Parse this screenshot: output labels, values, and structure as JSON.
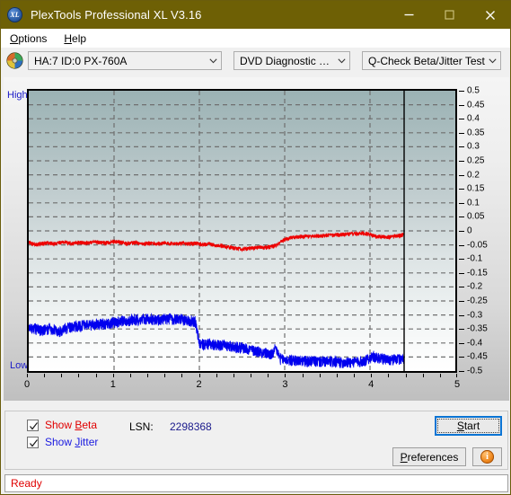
{
  "window": {
    "title": "PlexTools Professional XL V3.16",
    "icon": "xl-logo-icon",
    "minimize_label": "minimize-icon",
    "maximize_label": "maximize-icon",
    "close_label": "close-icon",
    "titlebar_color": "#6e6005"
  },
  "menu": {
    "items": [
      {
        "label": "Options",
        "accel": "O"
      },
      {
        "label": "Help",
        "accel": "H"
      }
    ]
  },
  "toolbar": {
    "drive": {
      "value": "HA:7 ID:0  PX-760A",
      "icon": "disc-drive-icon"
    },
    "function": {
      "value": "DVD Diagnostic Functions"
    },
    "test": {
      "value": "Q-Check Beta/Jitter Test"
    }
  },
  "chart_panel": {
    "high_label": "High",
    "low_label": "Low"
  },
  "controls": {
    "show_beta": {
      "label": "Show Beta",
      "accel": "B",
      "checked": true,
      "color": "#e00000"
    },
    "show_jitter": {
      "label": "Show Jitter",
      "accel": "J",
      "checked": true,
      "color": "#1919e0"
    },
    "lsn_label": "LSN:",
    "lsn_value": "2298368",
    "start_button": {
      "label": "Start",
      "accel": "S"
    },
    "preferences_button": {
      "label": "Preferences",
      "accel": "P"
    },
    "info_button": {
      "label": "i",
      "icon": "info-icon"
    }
  },
  "statusbar": {
    "text": "Ready",
    "color": "#e00000"
  },
  "chart_data": {
    "type": "line",
    "title": "Q-Check Beta/Jitter Test",
    "xlabel": "",
    "ylabel": "",
    "xlim": [
      0,
      5
    ],
    "ylim": [
      -0.5,
      0.5
    ],
    "x_ticks": [
      0,
      1,
      2,
      3,
      4,
      5
    ],
    "y_ticks": [
      0.5,
      0.45,
      0.4,
      0.35,
      0.3,
      0.25,
      0.2,
      0.15,
      0.1,
      0.05,
      0,
      -0.05,
      -0.1,
      -0.15,
      -0.2,
      -0.25,
      -0.3,
      -0.35,
      -0.4,
      -0.45,
      -0.5
    ],
    "grid": true,
    "legend_position": "bottom-left",
    "data_end_x": 4.4,
    "cursor_line_x": 4.4,
    "series": [
      {
        "name": "Show Beta",
        "color": "#ee0000",
        "x": [
          0.0,
          0.05,
          0.1,
          0.15,
          0.2,
          0.25,
          0.3,
          0.35,
          0.4,
          0.45,
          0.5,
          0.55,
          0.6,
          0.65,
          0.7,
          0.75,
          0.8,
          0.85,
          0.9,
          0.95,
          1.0,
          1.05,
          1.1,
          1.15,
          1.2,
          1.25,
          1.3,
          1.35,
          1.4,
          1.45,
          1.5,
          1.55,
          1.6,
          1.65,
          1.7,
          1.75,
          1.8,
          1.85,
          1.9,
          1.95,
          2.0,
          2.05,
          2.1,
          2.15,
          2.2,
          2.25,
          2.3,
          2.35,
          2.4,
          2.45,
          2.5,
          2.55,
          2.6,
          2.65,
          2.7,
          2.75,
          2.8,
          2.85,
          2.9,
          2.95,
          3.0,
          3.05,
          3.1,
          3.15,
          3.2,
          3.25,
          3.3,
          3.35,
          3.4,
          3.45,
          3.5,
          3.55,
          3.6,
          3.65,
          3.7,
          3.75,
          3.8,
          3.85,
          3.9,
          3.95,
          4.0,
          4.05,
          4.1,
          4.15,
          4.2,
          4.25,
          4.3,
          4.35,
          4.4
        ],
        "y": [
          -0.04,
          -0.046,
          -0.048,
          -0.045,
          -0.043,
          -0.044,
          -0.046,
          -0.042,
          -0.039,
          -0.041,
          -0.044,
          -0.042,
          -0.04,
          -0.043,
          -0.042,
          -0.04,
          -0.038,
          -0.041,
          -0.043,
          -0.04,
          -0.038,
          -0.039,
          -0.042,
          -0.045,
          -0.043,
          -0.04,
          -0.044,
          -0.046,
          -0.044,
          -0.043,
          -0.045,
          -0.044,
          -0.042,
          -0.044,
          -0.046,
          -0.045,
          -0.044,
          -0.046,
          -0.045,
          -0.044,
          -0.046,
          -0.047,
          -0.046,
          -0.048,
          -0.05,
          -0.052,
          -0.055,
          -0.058,
          -0.06,
          -0.062,
          -0.064,
          -0.063,
          -0.061,
          -0.06,
          -0.058,
          -0.059,
          -0.057,
          -0.055,
          -0.05,
          -0.04,
          -0.03,
          -0.025,
          -0.022,
          -0.021,
          -0.02,
          -0.019,
          -0.019,
          -0.018,
          -0.018,
          -0.017,
          -0.016,
          -0.015,
          -0.014,
          -0.013,
          -0.012,
          -0.011,
          -0.01,
          -0.009,
          -0.008,
          -0.009,
          -0.012,
          -0.018,
          -0.02,
          -0.019,
          -0.022,
          -0.02,
          -0.018,
          -0.016,
          -0.012
        ],
        "noise": 0.006
      },
      {
        "name": "Show Jitter",
        "color": "#0000ee",
        "x": [
          0.0,
          0.05,
          0.1,
          0.15,
          0.2,
          0.25,
          0.3,
          0.35,
          0.4,
          0.45,
          0.5,
          0.55,
          0.6,
          0.65,
          0.7,
          0.75,
          0.8,
          0.85,
          0.9,
          0.95,
          1.0,
          1.05,
          1.1,
          1.15,
          1.2,
          1.25,
          1.3,
          1.35,
          1.4,
          1.45,
          1.5,
          1.55,
          1.6,
          1.65,
          1.7,
          1.75,
          1.8,
          1.85,
          1.9,
          1.95,
          2.0,
          2.05,
          2.1,
          2.15,
          2.2,
          2.25,
          2.3,
          2.35,
          2.4,
          2.45,
          2.5,
          2.55,
          2.6,
          2.65,
          2.7,
          2.75,
          2.8,
          2.85,
          2.9,
          2.95,
          3.0,
          3.05,
          3.1,
          3.15,
          3.2,
          3.25,
          3.3,
          3.35,
          3.4,
          3.45,
          3.5,
          3.55,
          3.6,
          3.65,
          3.7,
          3.75,
          3.8,
          3.85,
          3.9,
          3.95,
          4.0,
          4.05,
          4.1,
          4.15,
          4.2,
          4.25,
          4.3,
          4.35,
          4.4
        ],
        "y": [
          -0.35,
          -0.345,
          -0.348,
          -0.352,
          -0.35,
          -0.347,
          -0.349,
          -0.36,
          -0.352,
          -0.345,
          -0.34,
          -0.338,
          -0.336,
          -0.334,
          -0.333,
          -0.332,
          -0.331,
          -0.33,
          -0.329,
          -0.328,
          -0.325,
          -0.322,
          -0.32,
          -0.318,
          -0.316,
          -0.315,
          -0.314,
          -0.313,
          -0.313,
          -0.314,
          -0.315,
          -0.314,
          -0.313,
          -0.312,
          -0.313,
          -0.314,
          -0.315,
          -0.316,
          -0.318,
          -0.32,
          -0.4,
          -0.402,
          -0.401,
          -0.403,
          -0.404,
          -0.405,
          -0.406,
          -0.408,
          -0.41,
          -0.412,
          -0.414,
          -0.418,
          -0.422,
          -0.425,
          -0.428,
          -0.432,
          -0.436,
          -0.44,
          -0.42,
          -0.455,
          -0.458,
          -0.459,
          -0.46,
          -0.461,
          -0.462,
          -0.462,
          -0.463,
          -0.463,
          -0.464,
          -0.464,
          -0.465,
          -0.465,
          -0.466,
          -0.466,
          -0.467,
          -0.467,
          -0.466,
          -0.465,
          -0.463,
          -0.46,
          -0.45,
          -0.448,
          -0.452,
          -0.455,
          -0.456,
          -0.457,
          -0.456,
          -0.455,
          -0.455
        ],
        "noise": 0.018
      }
    ]
  }
}
